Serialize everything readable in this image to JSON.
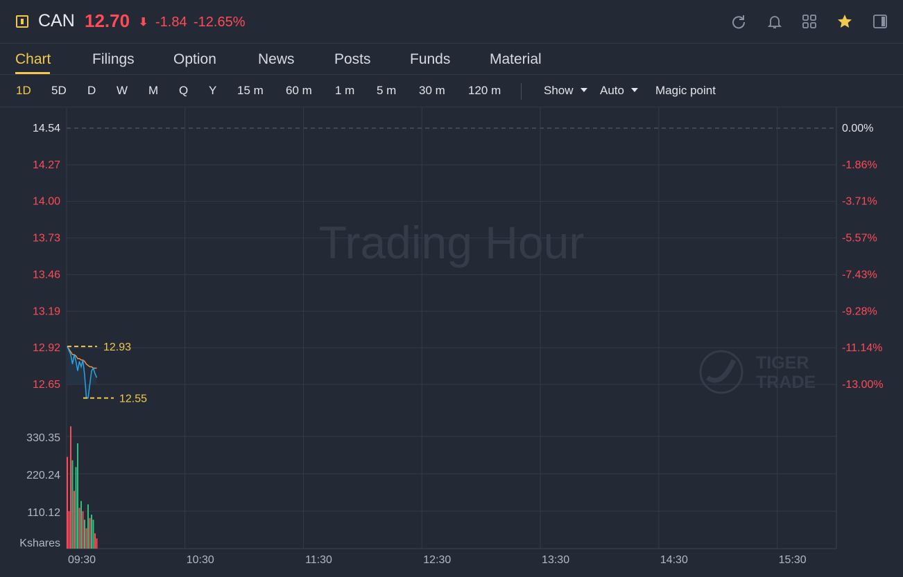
{
  "header": {
    "symbol": "CAN",
    "price": "12.70",
    "arrow": "⬇",
    "change": "-1.84",
    "change_pct": "-12.65%",
    "icons": [
      "refresh-icon",
      "bell-icon",
      "grid-icon",
      "star-icon",
      "panel-icon"
    ],
    "colors": {
      "down": "#ff4b57",
      "accent": "#f2c94c",
      "up": "#2ec27e"
    }
  },
  "tabs": [
    "Chart",
    "Filings",
    "Option",
    "News",
    "Posts",
    "Funds",
    "Material"
  ],
  "active_tab": "Chart",
  "periods": [
    "1D",
    "5D",
    "D",
    "W",
    "M",
    "Q",
    "Y",
    "15 m",
    "60 m",
    "1 m",
    "5 m",
    "30 m",
    "120 m"
  ],
  "active_period": "1D",
  "toolbar": {
    "show_label": "Show",
    "auto_label": "Auto",
    "magic_label": "Magic point"
  },
  "watermark": {
    "text": "Trading Hour",
    "brand_line1": "TIGER",
    "brand_line2": "TRADE"
  },
  "chart_data": {
    "type": "line",
    "y_ticks": [
      "14.54",
      "14.27",
      "14.00",
      "13.73",
      "13.46",
      "13.19",
      "12.92",
      "12.65"
    ],
    "pct_ticks": [
      "0.00%",
      "-1.86%",
      "-3.71%",
      "-5.57%",
      "-7.43%",
      "-9.28%",
      "-11.14%",
      "-13.00%"
    ],
    "ylim": [
      12.65,
      14.54
    ],
    "prev_close": 14.54,
    "x_ticks": [
      "09:30",
      "10:30",
      "11:30",
      "12:30",
      "13:30",
      "14:30",
      "15:30"
    ],
    "high_label": "12.93",
    "low_label": "12.55",
    "high": 12.93,
    "low": 12.55,
    "series": [
      {
        "values": [
          12.93,
          12.9,
          12.87,
          12.8,
          12.87,
          12.82,
          12.75,
          12.82,
          12.78,
          12.83,
          12.72,
          12.55,
          12.55,
          12.65,
          12.75,
          12.77,
          12.73,
          12.7
        ]
      },
      {
        "values": [
          12.93,
          12.91,
          12.89,
          12.87,
          12.87,
          12.86,
          12.84,
          12.84,
          12.83,
          12.83,
          12.82,
          12.8,
          12.79,
          12.78,
          12.78,
          12.77,
          12.77,
          12.77
        ]
      }
    ],
    "volume": {
      "unit_label": "Kshares",
      "ticks": [
        "330.35",
        "220.24",
        "110.12"
      ],
      "ylim": [
        0,
        330.35
      ],
      "values": [
        270,
        110,
        360,
        260,
        170,
        240,
        310,
        120,
        140,
        110,
        85,
        60,
        130,
        90,
        100,
        85,
        45,
        30
      ],
      "directions": [
        "down",
        "down",
        "down",
        "up",
        "down",
        "up",
        "up",
        "down",
        "up",
        "down",
        "up",
        "down",
        "up",
        "down",
        "up",
        "up",
        "down",
        "down"
      ]
    }
  }
}
